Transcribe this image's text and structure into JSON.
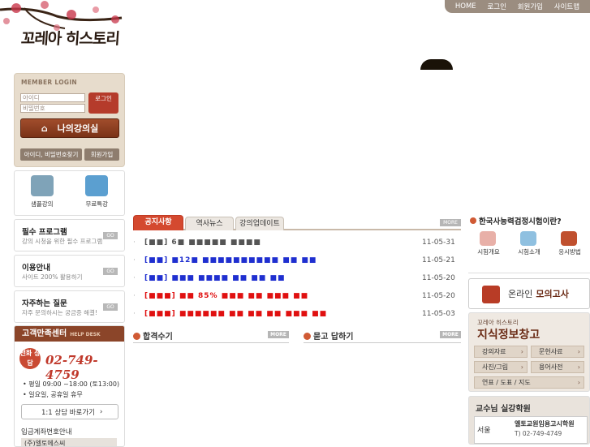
{
  "header": {
    "logo": "꼬레아 히스토리",
    "nav": [
      "HOME",
      "로그인",
      "회원가입",
      "사이트맵"
    ]
  },
  "login": {
    "title": "MEMBER LOGIN",
    "id_placeholder": "아이디",
    "pw_placeholder": "비밀번호",
    "login_btn": "로그인",
    "my_class": "나의강의실",
    "find_btn": "아이디, 비밀번호찾기",
    "join_btn": "회원가입"
  },
  "quick": [
    {
      "label": "샘플강의",
      "icon": "sample-lecture-icon"
    },
    {
      "label": "무료특강",
      "icon": "free-lecture-icon"
    }
  ],
  "promos": [
    {
      "title": "필수 프로그램",
      "sub": "강의 시청을 위한 필수 프로그램",
      "go": "GO"
    },
    {
      "title": "이용안내",
      "sub": "사이트 200% 활용하기",
      "go": "GO"
    },
    {
      "title": "자주하는 질문",
      "sub": "자주 문의하시는 궁금증 해결!",
      "go": "GO"
    }
  ],
  "help": {
    "title": "고객만족센터",
    "title_en": "HELP DESK",
    "phone_label": "전화 상담",
    "phone": "02-749-4759",
    "hours": "• 평일 09:00 ~18:00 (토13:00)",
    "holiday": "• 일요일, 공휴일 휴무",
    "consult_btn": "1:1 상담 바로가기",
    "bank_title": "입금계좌번호안내",
    "bank_name": "(주)엘토에스씨"
  },
  "center": {
    "tabs": [
      "공지사항",
      "역사뉴스",
      "강의업데이트"
    ],
    "more": "MORE",
    "notices": [
      {
        "title": "[■■] 6■ ■■■■■ ■■■■",
        "date": "11-05-31",
        "color": "#555555"
      },
      {
        "title": "[■■] ■12■ ■■■■■■■■■■ ■■ ■■",
        "date": "11-05-21",
        "color": "#1f2fd0"
      },
      {
        "title": "[■■] ■■■ ■■■■ ■■ ■■ ■■",
        "date": "11-05-20",
        "color": "#1f2fd0"
      },
      {
        "title": "[■■■] ■■ 85% ■■■ ■■ ■■■ ■■",
        "date": "11-05-20",
        "color": "#e01010"
      },
      {
        "title": "[■■■] ■■■■■■ ■■ ■■ ■■ ■■■ ■■",
        "date": "11-05-03",
        "color": "#e01010"
      }
    ],
    "sub_left": "합격수기",
    "sub_right": "묻고 답하기"
  },
  "right": {
    "exam_title": "한국사능력검정시험이란?",
    "exam_items": [
      {
        "label": "시험개요",
        "icon": "exam-overview-icon"
      },
      {
        "label": "시험소개",
        "icon": "exam-intro-icon"
      },
      {
        "label": "응시방법",
        "icon": "exam-method-icon"
      }
    ],
    "mock_pre": "온라인",
    "mock_main": "모의고사",
    "jj_small": "꼬레아 히스토리",
    "jj_title": "지식정보창고",
    "jj_links": [
      "강의자료",
      "문헌사료",
      "사진/그림",
      "용어사전",
      "연표 / 도표 / 지도"
    ],
    "prof_title": "교수님 실강학원",
    "region": "서울",
    "academy": "엘토교원임용고시학원",
    "tel": "T) 02-749-4749"
  }
}
